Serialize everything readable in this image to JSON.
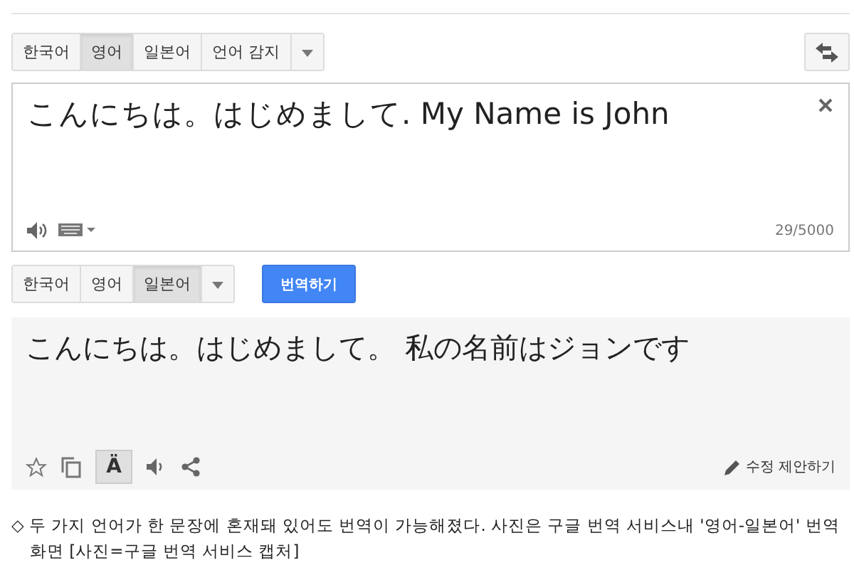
{
  "source_languages": [
    {
      "label": "한국어",
      "selected": false
    },
    {
      "label": "영어",
      "selected": true
    },
    {
      "label": "일본어",
      "selected": false
    },
    {
      "label": "언어 감지",
      "selected": false
    }
  ],
  "source": {
    "text": "こんにちは。はじめまして. My Name is John",
    "char_count": "29/5000"
  },
  "target_languages": [
    {
      "label": "한국어",
      "selected": false
    },
    {
      "label": "영어",
      "selected": false
    },
    {
      "label": "일본어",
      "selected": true
    }
  ],
  "translate_button": "번역하기",
  "result": {
    "text": "こんにちは。はじめまして。 私の名前はジョンです",
    "romanization_on": true,
    "romanization_glyph": "Ä",
    "suggest_edit": "수정 제안하기"
  },
  "caption": "◇ 두 가지 언어가 한 문장에 혼재돼 있어도 번역이 가능해졌다. 사진은 구글 번역 서비스내 '영어-일본어' 번역 화면 [사진=구글 번역 서비스 캡처]"
}
